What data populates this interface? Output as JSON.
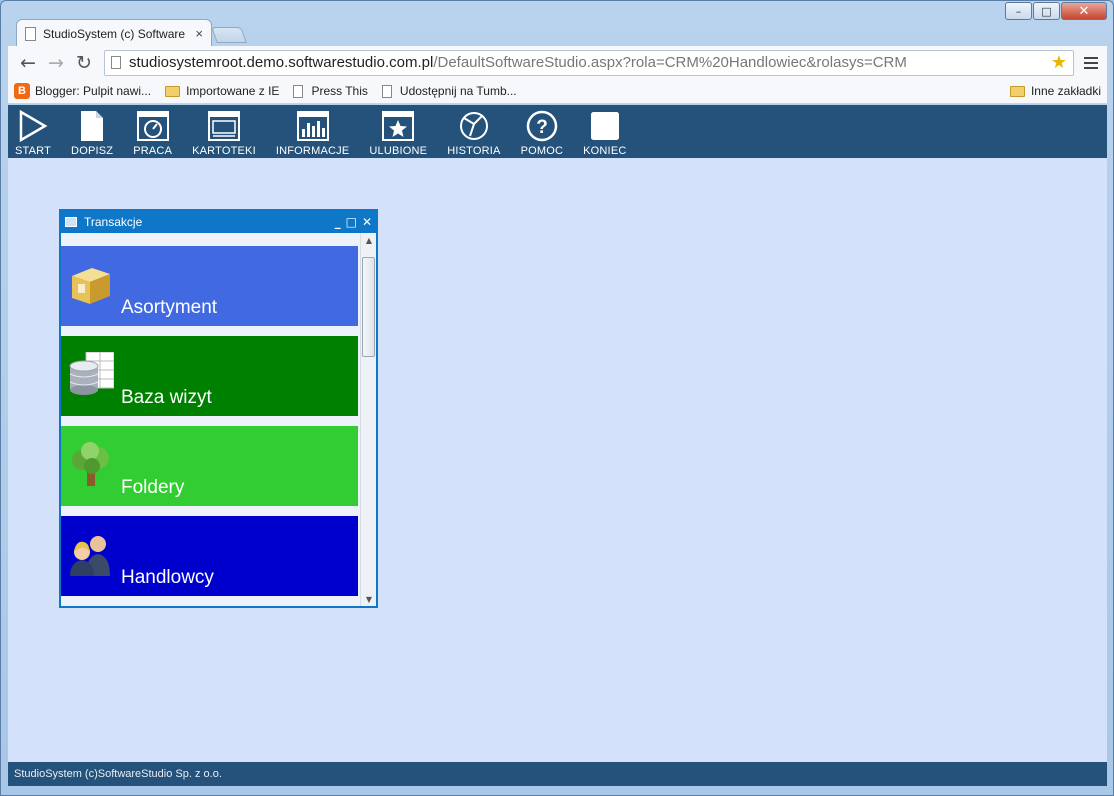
{
  "browser": {
    "tab_title": "StudioSystem (c) Software",
    "tab_close": "×",
    "url_host": "studiosystemroot.demo.softwarestudio.com.pl",
    "url_path": "/DefaultSoftwareStudio.aspx?rola=CRM%20Handlowiec&rolasys=CRM",
    "back": "←",
    "forward": "→",
    "reload": "↻",
    "star": "★",
    "window_controls": {
      "minimize": "–",
      "maximize": "□",
      "close": "✕"
    }
  },
  "bookmarks": {
    "items": [
      {
        "label": "Blogger: Pulpit nawi...",
        "icon": "blogger-icon"
      },
      {
        "label": "Importowane z IE",
        "icon": "folder-icon"
      },
      {
        "label": "Press This",
        "icon": "page-icon"
      },
      {
        "label": "Udostępnij na Tumb...",
        "icon": "page-icon"
      }
    ],
    "other": {
      "label": "Inne zakładki",
      "icon": "folder-icon"
    }
  },
  "app_menu": {
    "items": [
      {
        "label": "START",
        "icon": "play-icon"
      },
      {
        "label": "DOPISZ",
        "icon": "document-icon"
      },
      {
        "label": "PRACA",
        "icon": "gauge-icon"
      },
      {
        "label": "KARTOTEKI",
        "icon": "window-icon"
      },
      {
        "label": "INFORMACJE",
        "icon": "bar-chart-icon"
      },
      {
        "label": "ULUBIONE",
        "icon": "star-icon"
      },
      {
        "label": "HISTORIA",
        "icon": "history-icon"
      },
      {
        "label": "POMOC",
        "icon": "help-icon"
      },
      {
        "label": "KONIEC",
        "icon": "exit-icon"
      }
    ]
  },
  "panel": {
    "title": "Transakcje",
    "controls": {
      "minimize": "_",
      "maximize": "□",
      "close": "✕"
    },
    "tiles": [
      {
        "label": "Asortyment",
        "icon": "box-icon",
        "color": "#4169e1"
      },
      {
        "label": "Baza wizyt",
        "icon": "database-icon",
        "color": "#008000"
      },
      {
        "label": "Foldery",
        "icon": "tree-icon",
        "color": "#32cd32"
      },
      {
        "label": "Handlowcy",
        "icon": "people-icon",
        "color": "#0000cd"
      }
    ]
  },
  "footer": {
    "text": "StudioSystem (c)SoftwareStudio Sp. z o.o."
  },
  "colors": {
    "menu_bar": "#24527a",
    "app_bg": "#d3e1fb",
    "panel_border": "#0e77c7"
  }
}
